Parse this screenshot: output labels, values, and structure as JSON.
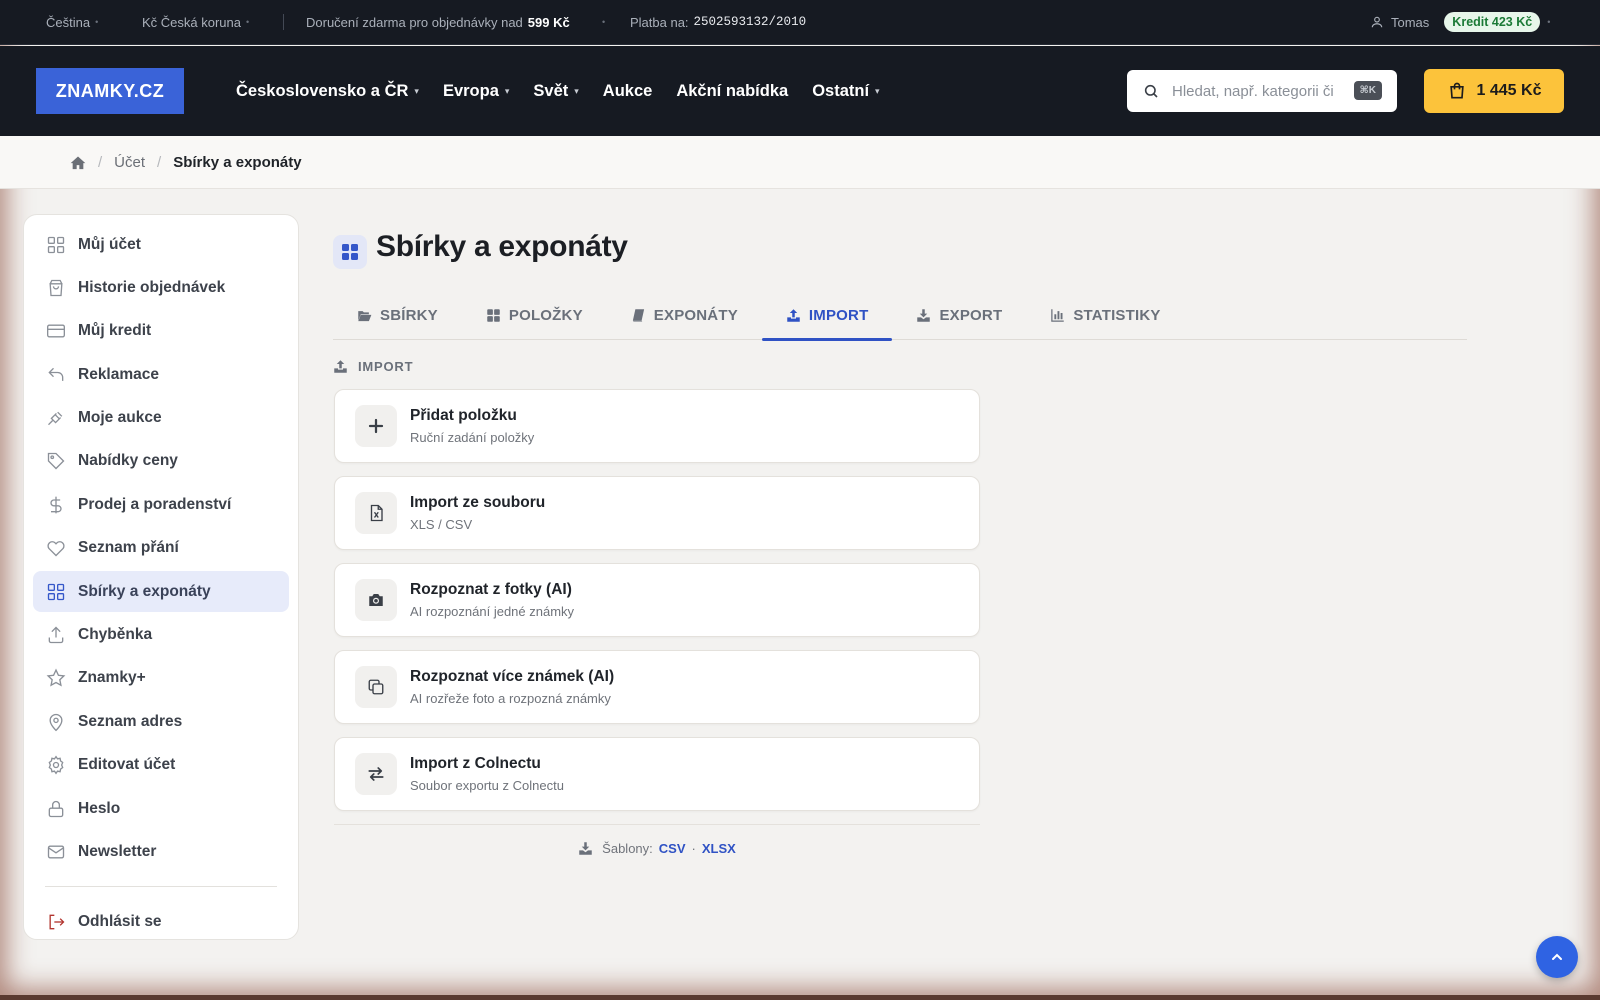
{
  "topbar": {
    "language": "Čeština",
    "currency": "Kč Česká koruna",
    "shipping_prefix": "Doručení zdarma pro objednávky nad",
    "shipping_amount": "599 Kč",
    "payment_prefix": "Platba na:",
    "payment_account": "2502593132/2010",
    "user": "Tomas",
    "credit": "Kredit 423 Kč"
  },
  "header": {
    "logo": "ZNAMKY.CZ",
    "nav": [
      "Československo a ČR",
      "Evropa",
      "Svět",
      "Aukce",
      "Akční nabídka",
      "Ostatní"
    ],
    "search_placeholder": "Hledat, např. kategorii či",
    "search_shortcut": "⌘K",
    "cart_total": "1 445 Kč"
  },
  "breadcrumb": {
    "account": "Účet",
    "current": "Sbírky a exponáty"
  },
  "sidebar": {
    "items": [
      {
        "label": "Můj účet",
        "icon": "grid-icon"
      },
      {
        "label": "Historie objednávek",
        "icon": "shopping-bag-icon"
      },
      {
        "label": "Můj kredit",
        "icon": "credit-card-icon"
      },
      {
        "label": "Reklamace",
        "icon": "undo-arrow-icon"
      },
      {
        "label": "Moje aukce",
        "icon": "gavel-icon"
      },
      {
        "label": "Nabídky ceny",
        "icon": "tag-icon"
      },
      {
        "label": "Prodej a poradenství",
        "icon": "dollar-icon"
      },
      {
        "label": "Seznam přání",
        "icon": "heart-icon"
      },
      {
        "label": "Sbírky a exponáty",
        "icon": "grid-icon"
      },
      {
        "label": "Chyběnka",
        "icon": "upload-icon"
      },
      {
        "label": "Znamky+",
        "icon": "star-icon"
      },
      {
        "label": "Seznam adres",
        "icon": "map-pin-icon"
      },
      {
        "label": "Editovat účet",
        "icon": "gear-icon"
      },
      {
        "label": "Heslo",
        "icon": "lock-icon"
      },
      {
        "label": "Newsletter",
        "icon": "mail-icon"
      }
    ],
    "logout": "Odhlásit se"
  },
  "main": {
    "title": "Sbírky a exponáty",
    "tabs": [
      {
        "label": "SBÍRKY",
        "icon": "folder-open-icon"
      },
      {
        "label": "POLOŽKY",
        "icon": "th-large-icon"
      },
      {
        "label": "EXPONÁTY",
        "icon": "book-icon"
      },
      {
        "label": "IMPORT",
        "icon": "upload-icon"
      },
      {
        "label": "EXPORT",
        "icon": "download-icon"
      },
      {
        "label": "STATISTIKY",
        "icon": "bar-chart-icon"
      }
    ],
    "active_tab": "IMPORT",
    "section_label": "IMPORT",
    "options": [
      {
        "title": "Přidat položku",
        "subtitle": "Ruční zadání položky",
        "icon": "plus-icon"
      },
      {
        "title": "Import ze souboru",
        "subtitle": "XLS / CSV",
        "icon": "file-excel-icon"
      },
      {
        "title": "Rozpoznat z fotky (AI)",
        "subtitle": "AI rozpoznání jedné známky",
        "icon": "camera-icon"
      },
      {
        "title": "Rozpoznat více známek (AI)",
        "subtitle": "AI rozřeže foto a rozpozná známky",
        "icon": "copy-icon"
      },
      {
        "title": "Import z Colnectu",
        "subtitle": "Soubor exportu z Colnectu",
        "icon": "exchange-icon"
      }
    ],
    "templates_label": "Šablony:",
    "template_csv": "CSV",
    "template_sep": "·",
    "template_xlsx": "XLSX"
  },
  "colors": {
    "accent": "#2f52c4",
    "cart": "#fcc33b",
    "header_bg": "#161a22",
    "logo_bg": "#3a63d8",
    "credit_badge": "#1b7a36"
  }
}
